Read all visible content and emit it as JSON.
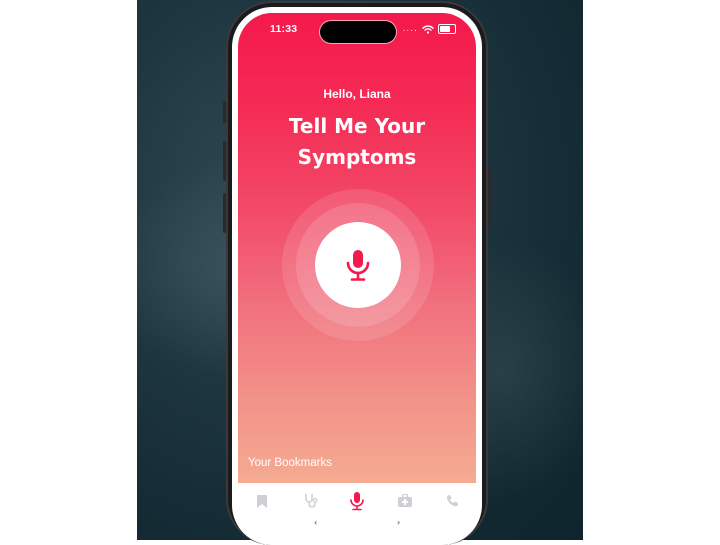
{
  "status_bar": {
    "time": "11:33",
    "dots": "...."
  },
  "greeting": "Hello, Liana",
  "headline": {
    "line1": "Tell Me Your",
    "line2": "Symptoms"
  },
  "bookmarks_label": "Your Bookmarks",
  "tabs": [
    {
      "id": "bookmarks",
      "icon": "bookmark-icon",
      "active": false
    },
    {
      "id": "doctor",
      "icon": "stethoscope-icon",
      "active": false
    },
    {
      "id": "voice",
      "icon": "microphone-icon",
      "active": true
    },
    {
      "id": "firstaid",
      "icon": "medical-kit-icon",
      "active": false
    },
    {
      "id": "call",
      "icon": "phone-icon",
      "active": false
    }
  ],
  "nav": {
    "back": "‹",
    "forward": "›"
  },
  "colors": {
    "accent": "#f4194c",
    "gradient_bottom": "#f5ab92",
    "inactive_tab": "#cfcfd4"
  }
}
